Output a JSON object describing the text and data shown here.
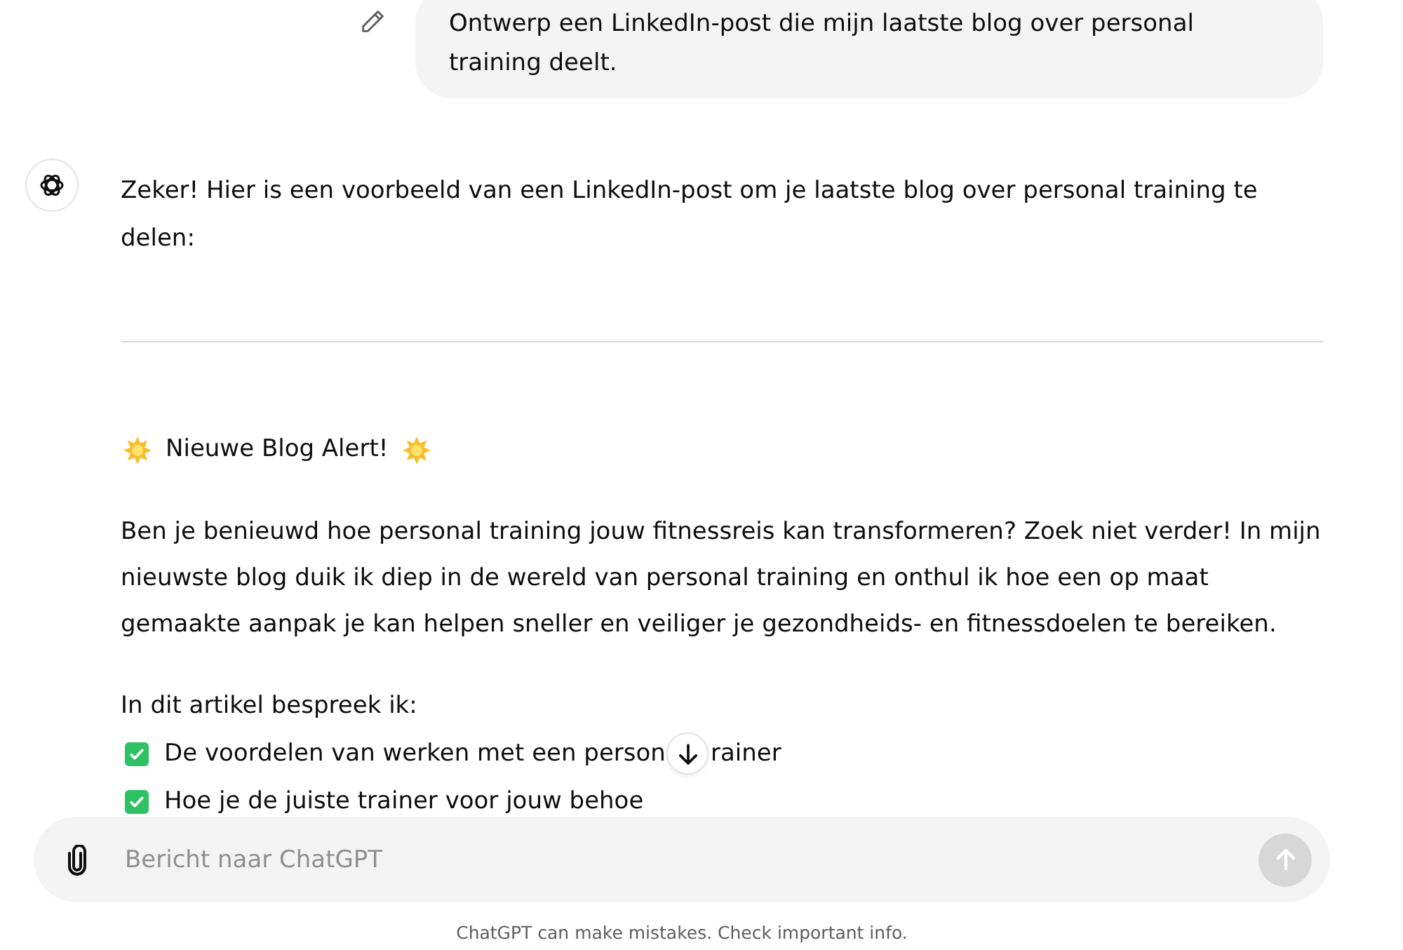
{
  "user_message": {
    "text": "Ontwerp een LinkedIn-post die mijn laatste blog over personal training deelt."
  },
  "assistant_message": {
    "intro": "Zeker! Hier is een voorbeeld van een LinkedIn-post om je laatste blog over personal training te delen:",
    "post": {
      "headline": "Nieuwe Blog Alert!",
      "body": "Ben je benieuwd hoe personal training jouw fitnessreis kan transformeren? Zoek niet verder! In mijn nieuwste blog duik ik diep in de wereld van personal training en onthul ik hoe een op maat gemaakte aanpak je kan helpen sneller en veiliger je gezondheids- en fitnessdoelen te bereiken.",
      "list_intro": "In dit artikel bespreek ik:",
      "list_items": [
        {
          "parts": [
            "De voordelen van werken met een person",
            "rainer"
          ]
        },
        {
          "parts": [
            "Hoe je de juiste trainer voor jouw behoe"
          ]
        }
      ]
    }
  },
  "composer": {
    "placeholder": "Bericht naar ChatGPT",
    "send_button": {
      "disabled": true
    }
  },
  "footer": "ChatGPT can make mistakes. Check important info."
}
